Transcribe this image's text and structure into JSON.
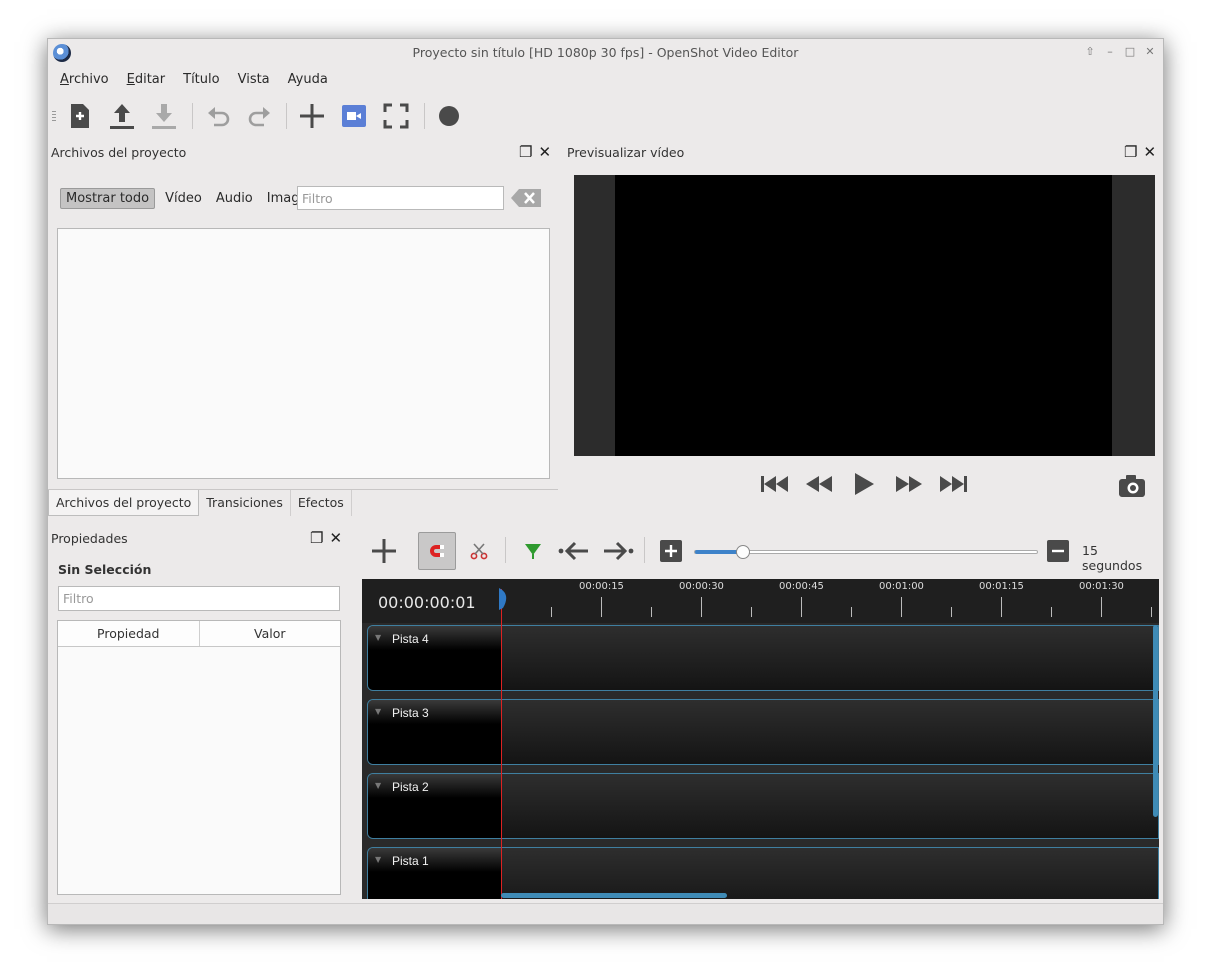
{
  "window": {
    "title": "Proyecto sin título [HD 1080p 30 fps] - OpenShot Video Editor",
    "controls": [
      "⇧",
      "–",
      "□",
      "✕"
    ]
  },
  "menu": {
    "items": [
      {
        "acc": "A",
        "rest": "rchivo"
      },
      {
        "acc": "E",
        "rest": "ditar"
      },
      {
        "acc": "",
        "rest": "Título"
      },
      {
        "acc": "",
        "rest": "Vista"
      },
      {
        "acc": "",
        "rest": "Ayuda"
      }
    ]
  },
  "toolbar": {
    "icons": [
      "new-project-icon",
      "open-project-icon",
      "save-project-icon",
      "undo-icon",
      "redo-icon",
      "import-files-icon",
      "profile-icon",
      "fullscreen-icon",
      "export-video-icon"
    ],
    "accent": "#5b7fd6"
  },
  "project_files": {
    "title": "Archivos del proyecto",
    "filters": {
      "all": "Mostrar todo",
      "video": "Vídeo",
      "audio": "Audio",
      "image": "Imagen"
    },
    "filter_placeholder": "Filtro"
  },
  "tabs": [
    "Archivos del proyecto",
    "Transiciones",
    "Efectos"
  ],
  "preview": {
    "title": "Previsualizar vídeo"
  },
  "properties": {
    "title": "Propiedades",
    "selection": "Sin Selección",
    "filter_placeholder": "Filtro",
    "col_property": "Propiedad",
    "col_value": "Valor"
  },
  "timeline": {
    "zoom_label": "15 segundos",
    "zoom_level": 0.14,
    "timecode": "00:00:00:01",
    "ticks": [
      "00:00:15",
      "00:00:30",
      "00:00:45",
      "00:01:00",
      "00:01:15",
      "00:01:30"
    ],
    "tracks": [
      "Pista 4",
      "Pista 3",
      "Pista 2",
      "Pista 1"
    ],
    "playhead_color": "#dd2222",
    "track_border": "#3f7fa0"
  }
}
